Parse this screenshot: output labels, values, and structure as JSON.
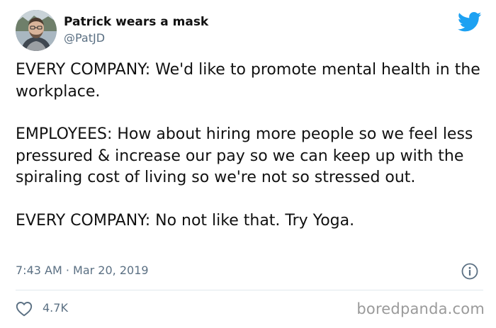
{
  "tweet": {
    "author": {
      "display_name": "Patrick wears a mask",
      "handle": "@PatJD",
      "avatar": "profile-photo"
    },
    "platform_icon": "twitter-bird-icon",
    "brand_color": "#1da1f2",
    "paragraphs": [
      "EVERY COMPANY: We'd like to promote mental health in the workplace.",
      "EMPLOYEES: How about hiring more people so we feel less pressured & increase our pay so we can keep up with the spiraling cost of living so we're not so stressed out.",
      "EVERY COMPANY: No not like that. Try Yoga."
    ],
    "timestamp": "7:43 AM · Mar 20, 2019",
    "info_icon": "info-icon",
    "likes": {
      "icon": "heart-icon",
      "count": "4.7K"
    }
  },
  "watermark": "boredpanda.com"
}
